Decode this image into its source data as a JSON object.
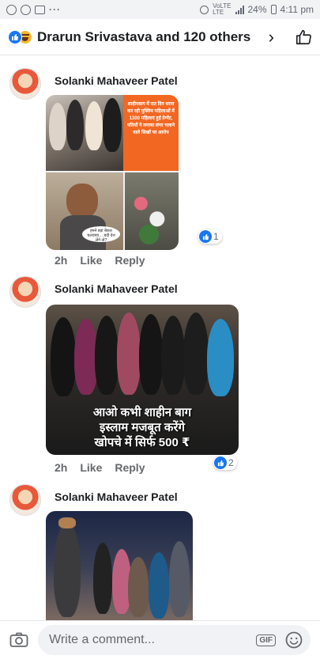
{
  "status_bar": {
    "battery": "24%",
    "time": "4:11 pm",
    "network_top": "VoLTE",
    "network_bottom": "LTE",
    "more": "···"
  },
  "header": {
    "title": "Drarun Srivastava and 120 others",
    "chevron": "›"
  },
  "comments": [
    {
      "author": "Solanki Mahaveer Patel",
      "media_text": "शाहीनबाग में रात दिन धरना कर रही मुस्लिम महिलाओं में 1300 महिलाएं हुई प्रेग्नेंट, पतियों ने लगाया लंगर चलाने वाले सिखों पर आरोप",
      "speech_text": "हमने बड़ा बेकार चलवाया… बदी देश लेंगे तो?",
      "time": "2h",
      "like_label": "Like",
      "reply_label": "Reply",
      "reaction_count": "1"
    },
    {
      "author": "Solanki Mahaveer Patel",
      "caption_line1": "आओ कभी शाहीन बाग",
      "caption_line2": "इस्लाम मजबूत करेंगे",
      "caption_line3": "खोपचे में सिर्फ 500 ₹",
      "time": "2h",
      "like_label": "Like",
      "reply_label": "Reply",
      "reaction_count": "2"
    },
    {
      "author": "Solanki Mahaveer Patel"
    }
  ],
  "composer": {
    "placeholder": "Write a comment...",
    "gif_label": "GIF"
  },
  "colors": {
    "brand_blue": "#1877f2",
    "orange_panel": "#f26722",
    "muted_text": "#65676b"
  }
}
